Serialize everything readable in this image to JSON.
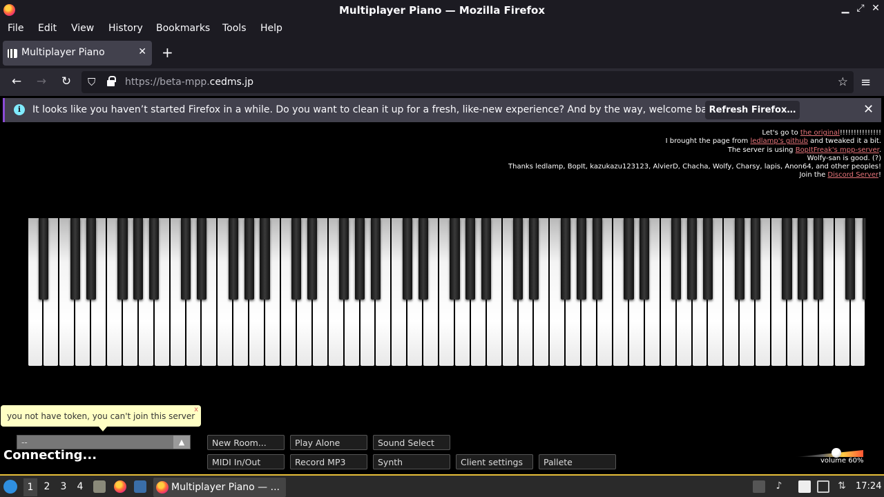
{
  "window": {
    "title": "Multiplayer Piano — Mozilla Firefox",
    "min": "▁",
    "max": "⤢",
    "close": "✕"
  },
  "menu": [
    "File",
    "Edit",
    "View",
    "History",
    "Bookmarks",
    "Tools",
    "Help"
  ],
  "tab": {
    "label": "Multiplayer Piano",
    "close": "✕",
    "new": "+"
  },
  "nav": {
    "back": "←",
    "forward": "→",
    "reload": "↻",
    "shield": "⛉",
    "url_prefix": "https://beta-mpp.",
    "url_domain": "cedms.jp",
    "star": "☆",
    "menu": "≡"
  },
  "infobar": {
    "icon": "i",
    "message": "It looks like you haven’t started Firefox in a while. Do you want to clean it up for a fresh, like-new experience? And by the way, welcome back!",
    "button": "Refresh Firefox…",
    "close": "✕"
  },
  "credits": {
    "l1_a": "Let's go to ",
    "l1_link": "the original",
    "l1_b": "!!!!!!!!!!!!!!!",
    "l2_a": "I brought the page from ",
    "l2_link": "ledlamp's github",
    "l2_b": " and tweaked it a bit.",
    "l3_a": "The server is using ",
    "l3_link": "BopItFreak's mpp-server",
    "l3_b": ".",
    "l4": "Wolfy-san is good. (?)",
    "l5": "Thanks ledlamp, BopIt, kazukazu123123, AlvierD, Chacha, Wolfy, Charsy, lapis, Anon64, and other peoples!",
    "l6_a": "Join the ",
    "l6_link": "Discord Server",
    "l6_b": "!"
  },
  "tooltip": {
    "text": "you not have token, you can't join this server",
    "close": "x"
  },
  "room": {
    "value": "--",
    "arrow": "▲"
  },
  "status": "Connecting...",
  "buttons": {
    "new_room": "New Room...",
    "play_alone": "Play Alone",
    "sound_select": "Sound Select",
    "midi": "MIDI In/Out",
    "record": "Record MP3",
    "synth": "Synth",
    "client_settings": "Client settings",
    "pallete": "Pallete"
  },
  "volume": {
    "label": "volume 60%",
    "level": 0.6
  },
  "taskbar": {
    "workspaces": [
      "1",
      "2",
      "3",
      "4"
    ],
    "task_label": "Multiplayer Piano — ...",
    "clock": "17:24"
  },
  "colors": {
    "link": "#e8757b",
    "accent": "#8b4bd6",
    "panel_border": "#e8c03a"
  }
}
